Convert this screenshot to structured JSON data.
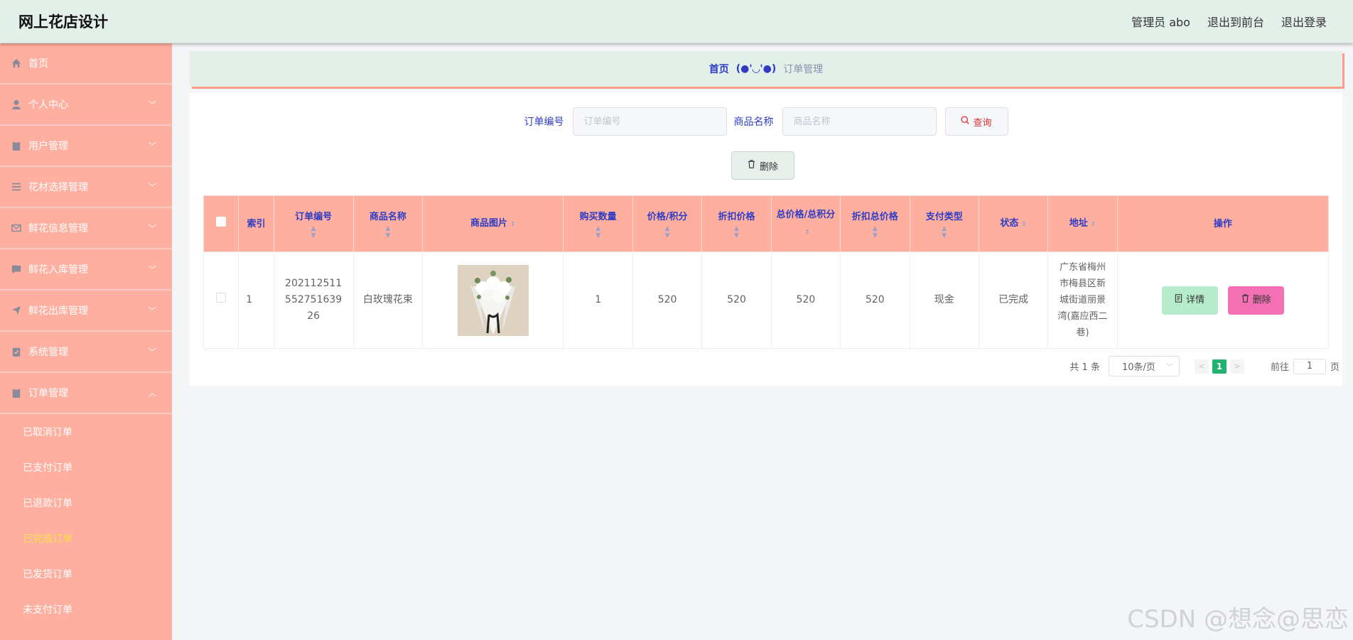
{
  "header": {
    "title": "网上花店设计",
    "admin_label": "管理员 abo",
    "back_to_front": "退出到前台",
    "logout": "退出登录"
  },
  "sidebar": {
    "items": [
      {
        "label": "首页",
        "icon": "home-icon",
        "expandable": false
      },
      {
        "label": "个人中心",
        "icon": "user-icon",
        "expandable": true
      },
      {
        "label": "用户管理",
        "icon": "clipboard-icon",
        "expandable": true
      },
      {
        "label": "花材选择管理",
        "icon": "list-icon",
        "expandable": true
      },
      {
        "label": "鲜花信息管理",
        "icon": "mail-icon",
        "expandable": true
      },
      {
        "label": "鲜花入库管理",
        "icon": "chat-icon",
        "expandable": true
      },
      {
        "label": "鲜花出库管理",
        "icon": "send-icon",
        "expandable": true
      },
      {
        "label": "系统管理",
        "icon": "check-clipboard-icon",
        "expandable": true
      },
      {
        "label": "订单管理",
        "icon": "clipboard-icon",
        "expandable": true,
        "expanded": true
      }
    ],
    "sub_items": [
      {
        "label": "已取消订单",
        "active": false
      },
      {
        "label": "已支付订单",
        "active": false
      },
      {
        "label": "已退款订单",
        "active": false
      },
      {
        "label": "已完成订单",
        "active": true
      },
      {
        "label": "已发货订单",
        "active": false
      },
      {
        "label": "未支付订单",
        "active": false
      }
    ]
  },
  "breadcrumb": {
    "home": "首页",
    "separator": "(●'◡'●)",
    "current": "订单管理"
  },
  "search": {
    "order_no_label": "订单编号",
    "order_no_placeholder": "订单编号",
    "product_label": "商品名称",
    "product_placeholder": "商品名称",
    "query_button": "查询"
  },
  "actions": {
    "delete_button": "删除"
  },
  "table": {
    "headers": {
      "index": "索引",
      "order_no": "订单编号",
      "product_name": "商品名称",
      "product_image": "商品图片",
      "quantity": "购买数量",
      "price": "价格/积分",
      "discount_price": "折扣价格",
      "total": "总价格/总积分",
      "discount_total": "折扣总价格",
      "pay_type": "支付类型",
      "status": "状态",
      "address": "地址",
      "operations": "操作"
    },
    "rows": [
      {
        "index": "1",
        "order_no": "202112511552751639 26",
        "order_no_lines": [
          "202112511",
          "552751639",
          "26"
        ],
        "product_name": "白玫瑰花束",
        "quantity": "1",
        "price": "520",
        "discount_price": "520",
        "total": "520",
        "discount_total": "520",
        "pay_type": "现金",
        "status": "已完成",
        "address_lines": [
          "广东省梅州",
          "市梅县区新",
          "城街道丽景",
          "湾(嘉应西二",
          "巷)"
        ],
        "detail_button": "详情",
        "delete_button": "删除"
      }
    ]
  },
  "pagination": {
    "total": "共 1 条",
    "page_size": "10条/页",
    "current_page": "1",
    "goto_label": "前往",
    "goto_value": "1",
    "page_suffix": "页"
  },
  "watermark": "CSDN @想念@思恋",
  "colors": {
    "header_bg": "#e3efe9",
    "sidebar_bg": "#ffafa0",
    "accent_blue": "#2e3dc4",
    "active_sub": "#f6e14b",
    "pager_active": "#22b373",
    "delete_pink": "#f470b4",
    "detail_green": "#b6ebcb"
  }
}
